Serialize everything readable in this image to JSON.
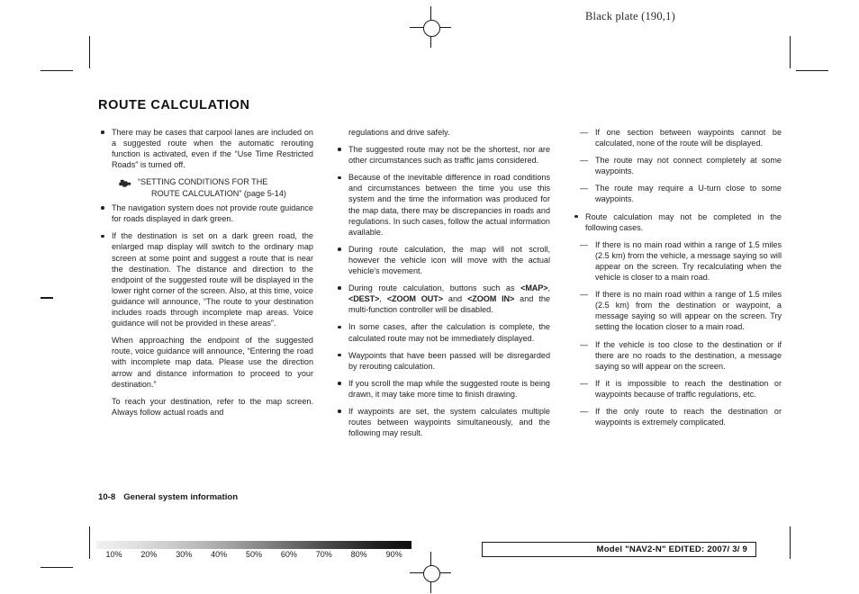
{
  "marks": {
    "black_plate": "Black plate (190,1)"
  },
  "page": {
    "title": "ROUTE CALCULATION",
    "footer_number": "10-8",
    "footer_title": "General system information",
    "model_box": "Model \"NAV2-N\"  EDITED:  2007/ 3/ 9"
  },
  "columns": {
    "col1": [
      {
        "type": "bullet",
        "text": "There may be cases that carpool lanes are included on a suggested route when the automatic rerouting function is activated, even if the “Use Time Restricted Roads” is turned off."
      },
      {
        "type": "reference",
        "icon": "pointing-hand-icon",
        "line1": "“SETTING CONDITIONS FOR THE",
        "line2": "ROUTE CALCULATION” (page 5-14)"
      },
      {
        "type": "bullet",
        "text": "The navigation system does not provide route guidance for roads displayed in dark green."
      },
      {
        "type": "bullet",
        "text": "If the destination is set on a dark green road, the enlarged map display will switch to the ordinary map screen at some point and suggest a route that is near the destination. The distance and direction to the endpoint of the suggested route will be displayed in the lower right corner of the screen. Also, at this time, voice guidance will announce, “The route to your destination includes roads through incomplete map areas. Voice guidance will not be provided in these areas”."
      },
      {
        "type": "plain",
        "text": "When approaching the endpoint of the suggested route, voice guidance will announce, “Entering the road with incomplete map data. Please use the direction arrow and distance information to proceed to your destination.”"
      },
      {
        "type": "plain",
        "text": "To reach your destination, refer to the map screen. Always follow actual roads and"
      }
    ],
    "col2": [
      {
        "type": "plain",
        "text": "regulations and drive safely."
      },
      {
        "type": "bullet",
        "text": "The suggested route may not be the shortest, nor are other circumstances such as traffic jams considered."
      },
      {
        "type": "bullet",
        "text": "Because of the inevitable difference in road conditions and circumstances between the time you use this system and the time the information was produced for the map data, there may be discrepancies in roads and regulations. In such cases, follow the actual information available."
      },
      {
        "type": "bullet",
        "text": "During route calculation, the map will not scroll, however the vehicle icon will move with the actual vehicle's movement."
      },
      {
        "type": "bullet-rich",
        "parts": [
          {
            "kind": "text",
            "value": "During route calculation, buttons such as "
          },
          {
            "kind": "kbd",
            "value": "<MAP>"
          },
          {
            "kind": "text",
            "value": ", "
          },
          {
            "kind": "kbd",
            "value": "<DEST>"
          },
          {
            "kind": "text",
            "value": ", "
          },
          {
            "kind": "kbd",
            "value": "<ZOOM OUT>"
          },
          {
            "kind": "text",
            "value": " and "
          },
          {
            "kind": "kbd",
            "value": "<ZOOM IN>"
          },
          {
            "kind": "text",
            "value": " and the multi-function controller will be disabled."
          }
        ]
      },
      {
        "type": "bullet",
        "text": "In some cases, after the calculation is complete, the calculated route may not be immediately displayed."
      },
      {
        "type": "bullet",
        "text": "Waypoints that have been passed will be disregarded by rerouting calculation."
      },
      {
        "type": "bullet",
        "text": "If you scroll the map while the suggested route is being drawn, it may take more time to finish drawing."
      },
      {
        "type": "bullet",
        "text": "If waypoints are set, the system calculates multiple routes between waypoints simultaneously, and the following may result."
      }
    ],
    "col3": [
      {
        "type": "dash",
        "text": "If one section between waypoints cannot be calculated, none of the route will be displayed."
      },
      {
        "type": "dash",
        "text": "The route may not connect completely at some waypoints."
      },
      {
        "type": "dash",
        "text": "The route may require a U-turn close to some waypoints."
      },
      {
        "type": "bullet",
        "text": "Route calculation may not be completed in the following cases."
      },
      {
        "type": "dash",
        "text": "If there is no main road within a range of 1.5 miles (2.5 km) from the vehicle, a message saying so will appear on the screen. Try recalculating when the vehicle is closer to a main road."
      },
      {
        "type": "dash",
        "text": "If there is no main road within a range of 1.5 miles (2.5 km) from the destination or waypoint, a message saying so will appear on the screen. Try setting the location closer to a main road."
      },
      {
        "type": "dash",
        "text": "If the vehicle is too close to the destination or if there are no roads to the destination, a message saying so will appear on the screen."
      },
      {
        "type": "dash",
        "text": "If it is impossible to reach the destination or waypoints because of traffic regulations, etc."
      },
      {
        "type": "dash",
        "text": "If the only route to reach the destination or waypoints is extremely complicated."
      }
    ]
  },
  "density_strip": {
    "labels": [
      "10%",
      "20%",
      "30%",
      "40%",
      "50%",
      "60%",
      "70%",
      "80%",
      "90%"
    ]
  }
}
